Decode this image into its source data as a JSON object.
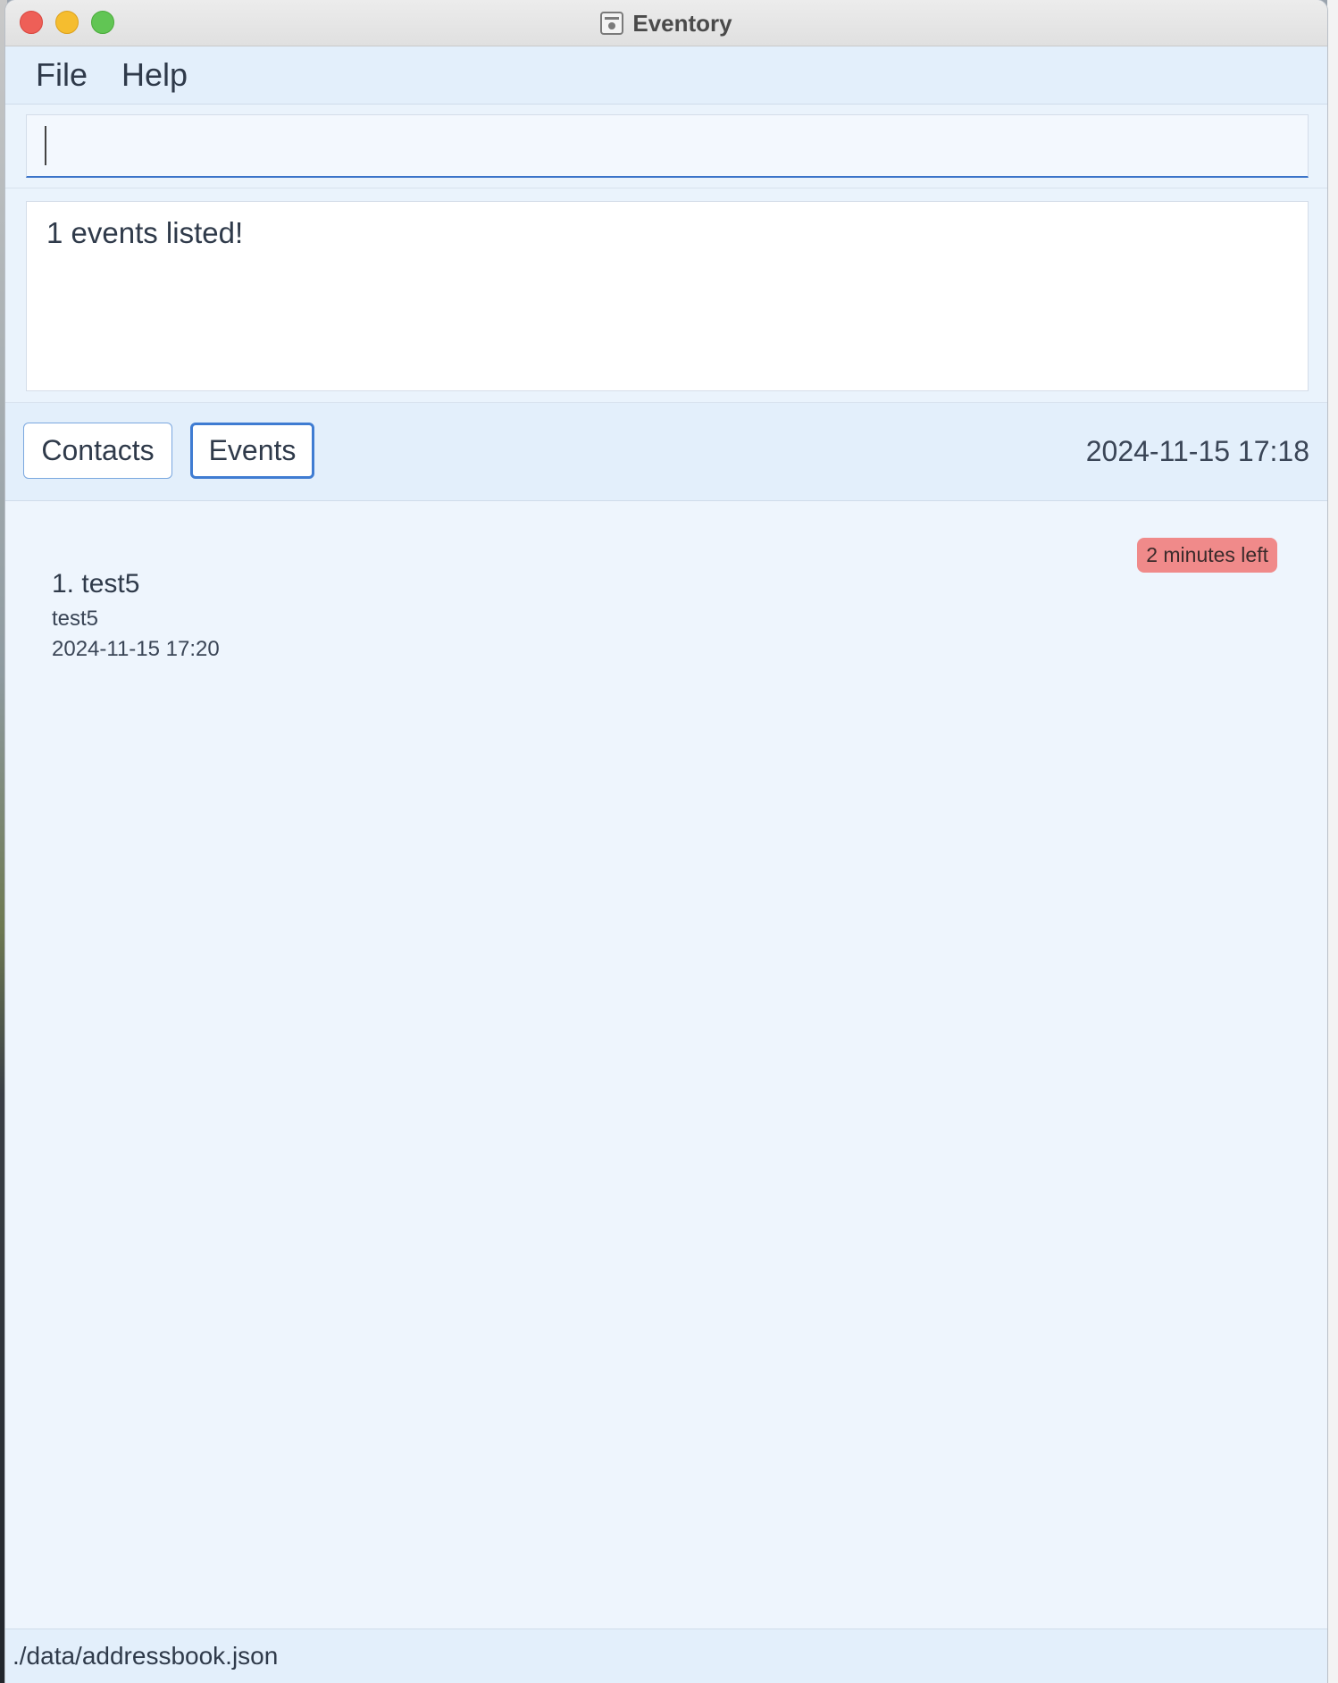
{
  "window": {
    "title": "Eventory"
  },
  "menu": {
    "file": "File",
    "help": "Help"
  },
  "command": {
    "value": ""
  },
  "result": {
    "message": "1 events listed!"
  },
  "toggle": {
    "contacts_label": "Contacts",
    "events_label": "Events",
    "active": "Events",
    "current_time": "2024-11-15 17:18"
  },
  "events": [
    {
      "index_title": "1. test5",
      "description": "test5",
      "datetime": "2024-11-15 17:20",
      "badge": "2 minutes left"
    }
  ],
  "status": {
    "file_path": "./data/addressbook.json"
  },
  "colors": {
    "accent": "#3f7cd2",
    "badge": "#f08a8a",
    "panel": "#e3effb"
  }
}
